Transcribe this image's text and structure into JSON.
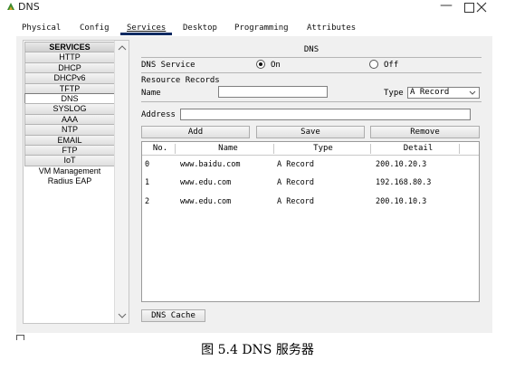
{
  "window": {
    "title": "DNS"
  },
  "tabs": [
    {
      "label": "Physical"
    },
    {
      "label": "Config"
    },
    {
      "label": "Services"
    },
    {
      "label": "Desktop"
    },
    {
      "label": "Programming"
    },
    {
      "label": "Attributes"
    }
  ],
  "sidebar": {
    "header": "SERVICES",
    "items": [
      "HTTP",
      "DHCP",
      "DHCPv6",
      "TFTP",
      "DNS",
      "SYSLOG",
      "AAA",
      "NTP",
      "EMAIL",
      "FTP",
      "IoT",
      "VM Management",
      "Radius EAP"
    ],
    "selected": "DNS"
  },
  "panel": {
    "title": "DNS",
    "service_label": "DNS Service",
    "on_label": "On",
    "off_label": "Off",
    "service_state": "On",
    "resource_records_label": "Resource Records",
    "name_label": "Name",
    "name_value": "",
    "type_label": "Type",
    "type_value": "A Record",
    "address_label": "Address",
    "address_value": "",
    "add_button": "Add",
    "save_button": "Save",
    "remove_button": "Remove",
    "cache_button": "DNS Cache"
  },
  "table": {
    "columns": [
      "No.",
      "Name",
      "Type",
      "Detail"
    ],
    "rows": [
      {
        "no": "0",
        "name": "www.baidu.com",
        "type": "A Record",
        "detail": "200.10.20.3"
      },
      {
        "no": "1",
        "name": "www.edu.com",
        "type": "A Record",
        "detail": "192.168.80.3"
      },
      {
        "no": "2",
        "name": "www.edu.com",
        "type": "A Record",
        "detail": "200.10.10.3"
      }
    ]
  },
  "caption": "图 5.4 DNS 服务器",
  "colors": {
    "tab_underline": "#0f2a62",
    "panel_bg": "#f0f0f0"
  }
}
